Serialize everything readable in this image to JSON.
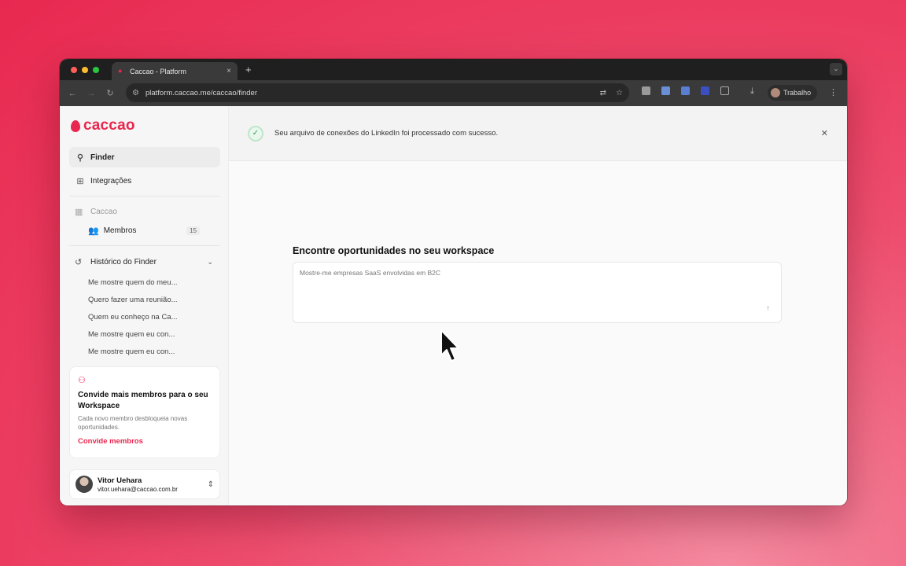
{
  "browser": {
    "tab_title": "Caccao - Platform",
    "tab_close": "×",
    "new_tab": "+",
    "url": "platform.caccao.me/caccao/finder",
    "profile_name": "Trabalho"
  },
  "brand": {
    "name": "caccao",
    "accent": "#e8284f"
  },
  "sidebar": {
    "nav": [
      {
        "label": "Finder",
        "icon": "search-icon"
      },
      {
        "label": "Integrações",
        "icon": "grid-icon"
      }
    ],
    "workspace": {
      "label": "Caccao",
      "icon": "building-icon"
    },
    "members": {
      "label": "Membros",
      "count": "15",
      "icon": "users-icon"
    },
    "history": {
      "label": "Histórico do Finder",
      "icon": "history-icon",
      "items": [
        "Me mostre quem do meu...",
        "Quero fazer uma reunião...",
        "Quem eu conheço na Ca...",
        "Me mostre quem eu con...",
        "Me mostre quem eu con..."
      ]
    },
    "invite": {
      "title": "Convide mais membros para o seu Workspace",
      "description": "Cada novo membro desbloqueia novas oportunidades.",
      "link": "Convide membros"
    },
    "user": {
      "name": "Vitor Uehara",
      "email": "vitor.uehara@caccao.com.br"
    }
  },
  "banner": {
    "message": "Seu arquivo de conexões do LinkedIn foi processado com sucesso.",
    "status_color": "#2e9e52"
  },
  "finder": {
    "heading": "Encontre oportunidades no seu workspace",
    "placeholder": "Mostre-me empresas SaaS envolvidas em B2C"
  }
}
